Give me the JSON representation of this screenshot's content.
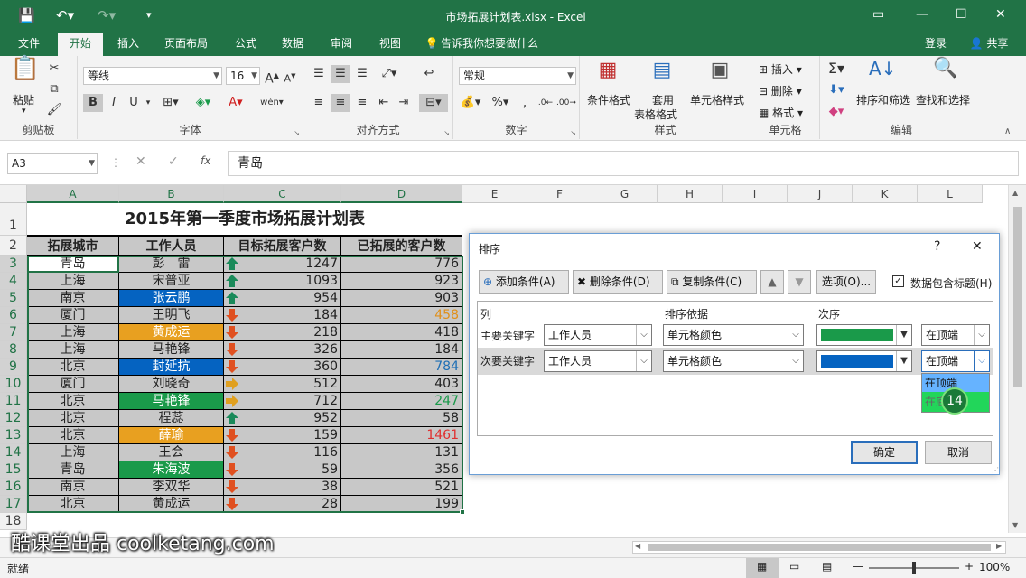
{
  "window": {
    "title": "_市场拓展计划表.xlsx - Excel",
    "login": "登录",
    "share": "共享"
  },
  "tabs": [
    "文件",
    "开始",
    "插入",
    "页面布局",
    "公式",
    "数据",
    "审阅",
    "视图"
  ],
  "tell_me": "告诉我你想要做什么",
  "ribbon": {
    "clipboard": {
      "label": "剪贴板",
      "paste": "粘贴"
    },
    "font": {
      "label": "字体",
      "name": "等线",
      "size": "16",
      "bold": "B",
      "italic": "I",
      "underline": "U"
    },
    "alignment": {
      "label": "对齐方式"
    },
    "number": {
      "label": "数字",
      "format": "常规"
    },
    "styles": {
      "label": "样式",
      "cond_format": "条件格式",
      "table_format_1": "套用",
      "table_format_2": "表格格式",
      "cell_styles": "单元格样式"
    },
    "cells": {
      "label": "单元格",
      "insert": "插入",
      "delete": "删除",
      "format": "格式"
    },
    "editing": {
      "label": "编辑",
      "sort_filter": "排序和筛选",
      "find_select": "查找和选择"
    }
  },
  "formula_bar": {
    "name_box": "A3",
    "fx": "fx",
    "content": "青岛"
  },
  "columns": [
    "A",
    "B",
    "C",
    "D",
    "E",
    "F",
    "G",
    "H",
    "I",
    "J",
    "K",
    "L"
  ],
  "sheet": {
    "title": "2015年第一季度市场拓展计划表",
    "headers": [
      "拓展城市",
      "工作人员",
      "目标拓展客户数",
      "已拓展的客户数"
    ],
    "rows": [
      {
        "row": "3",
        "city": "青岛",
        "person": "彭　雷",
        "target": "1247",
        "done": "776",
        "arrow": "up"
      },
      {
        "row": "4",
        "city": "上海",
        "person": "宋普亚",
        "target": "1093",
        "done": "923",
        "arrow": "up"
      },
      {
        "row": "5",
        "city": "南京",
        "person": "张云鹏",
        "target": "954",
        "done": "903",
        "arrow": "up"
      },
      {
        "row": "6",
        "city": "厦门",
        "person": "王明飞",
        "target": "184",
        "done": "458",
        "arrow": "down"
      },
      {
        "row": "7",
        "city": "上海",
        "person": "黄成运",
        "target": "218",
        "done": "418",
        "arrow": "down"
      },
      {
        "row": "8",
        "city": "上海",
        "person": "马艳锋",
        "target": "326",
        "done": "184",
        "arrow": "down"
      },
      {
        "row": "9",
        "city": "北京",
        "person": "封延抗",
        "target": "360",
        "done": "784",
        "arrow": "down"
      },
      {
        "row": "10",
        "city": "厦门",
        "person": "刘晓奇",
        "target": "512",
        "done": "403",
        "arrow": "right"
      },
      {
        "row": "11",
        "city": "北京",
        "person": "马艳锋",
        "target": "712",
        "done": "247",
        "arrow": "right"
      },
      {
        "row": "12",
        "city": "北京",
        "person": "程蕊",
        "target": "952",
        "done": "58",
        "arrow": "up"
      },
      {
        "row": "13",
        "city": "北京",
        "person": "薛瑜",
        "target": "159",
        "done": "1461",
        "arrow": "down"
      },
      {
        "row": "14",
        "city": "上海",
        "person": "王会",
        "target": "116",
        "done": "131",
        "arrow": "down"
      },
      {
        "row": "15",
        "city": "青岛",
        "person": "朱海波",
        "target": "59",
        "done": "356",
        "arrow": "down"
      },
      {
        "row": "16",
        "city": "南京",
        "person": "李双华",
        "target": "38",
        "done": "521",
        "arrow": "down"
      },
      {
        "row": "17",
        "city": "北京",
        "person": "黄成运",
        "target": "28",
        "done": "199",
        "arrow": "down"
      }
    ],
    "extra_rows": [
      "18"
    ]
  },
  "colors": {
    "excel_green": "#217346",
    "cell_blue": "#0563c1",
    "cell_orange": "#e8a020",
    "cell_green": "#1a9a4a",
    "row_gray": "#c8c8c8",
    "done_orange": "#e0901a",
    "done_blue": "#1f6fb5",
    "done_green": "#1a9a4a",
    "done_red": "#e03030"
  },
  "dialog": {
    "title": "排序",
    "help": "?",
    "close": "✕",
    "add_condition": "添加条件(A)",
    "delete_condition": "删除条件(D)",
    "copy_condition": "复制条件(C)",
    "options": "选项(O)...",
    "has_headers": "数据包含标题(H)",
    "col_header": "列",
    "sort_on_header": "排序依据",
    "order_header": "次序",
    "primary_label": "主要关键字",
    "secondary_label": "次要关键字",
    "primary_column": "工作人员",
    "primary_sort_on": "单元格颜色",
    "primary_position": "在顶端",
    "secondary_column": "工作人员",
    "secondary_sort_on": "单元格颜色",
    "secondary_position": "在顶端",
    "dropdown_option_1": "在顶端",
    "dropdown_option_2": "在底端",
    "step_badge": "14",
    "ok": "确定",
    "cancel": "取消"
  },
  "status": {
    "ready": "就绪",
    "zoom": "100%"
  },
  "watermark": "酷课堂出品 coolketang.com"
}
